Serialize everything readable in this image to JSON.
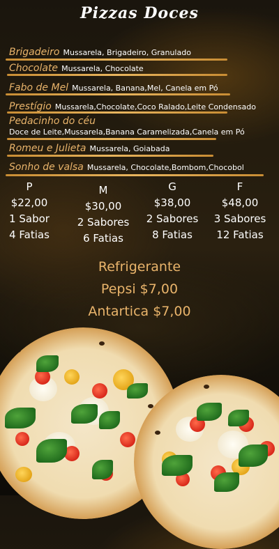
{
  "title": "Pizzas Doces",
  "flavors": [
    {
      "name": "Brigadeiro",
      "desc": "Mussarela, Brigadeiro, Granulado"
    },
    {
      "name": "Chocolate",
      "desc": "Mussarela, Chocolate"
    },
    {
      "name": "Fabo de Mel",
      "desc": "Mussarela, Banana,Mel, Canela em Pó"
    },
    {
      "name": "Prestígio",
      "desc": "Mussarela,Chocolate,Coco Ralado,Leite Condensado"
    },
    {
      "name": "Pedacinho do céu",
      "desc": "Doce de Leite,Mussarela,Banana Caramelizada,Canela em Pó"
    },
    {
      "name": "Romeu e Julieta",
      "desc": "Mussarela, Goiabada"
    },
    {
      "name": "Sonho de valsa",
      "desc": "Mussarela, Chocolate,Bombom,Chocobol"
    }
  ],
  "sizes": [
    {
      "size": "P",
      "price": "$22,00",
      "flavors": "1 Sabor",
      "slices": "4 Fatias"
    },
    {
      "size": "M",
      "price": "$30,00",
      "flavors": "2 Sabores",
      "slices": "6 Fatias"
    },
    {
      "size": "G",
      "price": "$38,00",
      "flavors": "2 Sabores",
      "slices": "8 Fatias"
    },
    {
      "size": "F",
      "price": "$48,00",
      "flavors": "3 Sabores",
      "slices": "12 Fatias"
    }
  ],
  "drinks": {
    "heading": "Refrigerante",
    "items": [
      "Pepsi $7,00",
      "Antartica $7,00"
    ]
  },
  "colors": {
    "accent": "#e9b46b",
    "stroke": "#d9a24a",
    "text": "#ffffff"
  }
}
